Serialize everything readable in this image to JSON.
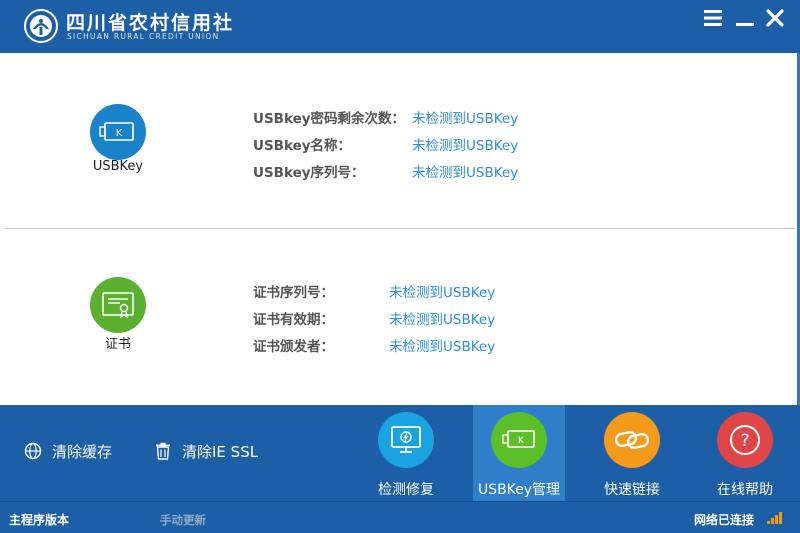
{
  "app": {
    "brand_cn": "四川省农村信用社",
    "brand_en": "SICHUAN RURAL CREDIT UNION"
  },
  "usbkey_panel": {
    "label": "USBKey",
    "badge_letter": "K",
    "rows": [
      {
        "label": "USBkey密码剩余次数：",
        "value": "未检测到USBKey"
      },
      {
        "label": "USBkey名称：",
        "value": "未检测到USBKey"
      },
      {
        "label": "USBkey序列号：",
        "value": "未检测到USBKey"
      }
    ]
  },
  "cert_panel": {
    "label": "证书",
    "rows": [
      {
        "label": "证书序列号：",
        "value": "未检测到USBKey"
      },
      {
        "label": "证书有效期：",
        "value": "未检测到USBKey"
      },
      {
        "label": "证书颁发者：",
        "value": "未检测到USBKey"
      }
    ]
  },
  "toolbar": {
    "clear_cache": "清除缓存",
    "clear_ssl": "清除IE SSL",
    "tools": [
      {
        "label": "检测修复",
        "icon": "monitor-repair-icon",
        "color": "#1aa3e0"
      },
      {
        "label": "USBKey管理",
        "icon": "usbkey-icon",
        "color": "#5cbf2a",
        "active": true
      },
      {
        "label": "快速链接",
        "icon": "link-icon",
        "color": "#f39a1b"
      },
      {
        "label": "在线帮助",
        "icon": "help-icon",
        "color": "#e0454a"
      }
    ]
  },
  "status": {
    "version_label": "主程序版本",
    "manual_update": "手动更新",
    "network": "网络已连接"
  },
  "colors": {
    "brand_blue": "#1d5fa6",
    "link_blue": "#2d8fd8",
    "usbkey_badge": "#1a82c9",
    "cert_badge": "#5cb030"
  }
}
